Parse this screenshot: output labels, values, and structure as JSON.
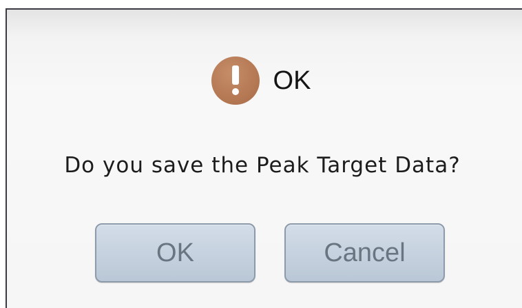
{
  "dialog": {
    "title": "OK",
    "icon": "exclamation-icon",
    "message": "Do you save the Peak Target Data?",
    "buttons": {
      "ok_label": "OK",
      "cancel_label": "Cancel"
    },
    "colors": {
      "icon": "#b57954",
      "button_fill": "#c5d1de",
      "button_text": "#6a7582"
    }
  }
}
